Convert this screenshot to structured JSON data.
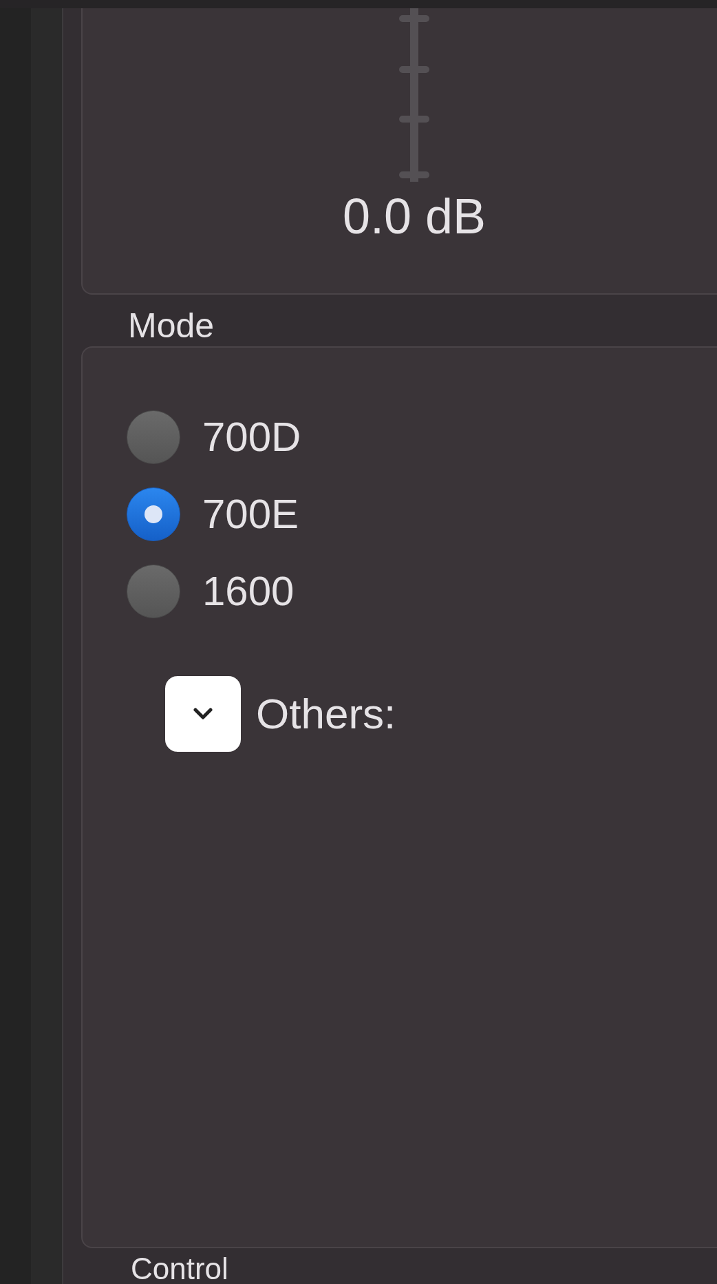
{
  "gain": {
    "reading": "0.0 dB"
  },
  "mode": {
    "label": "Mode",
    "options": [
      {
        "label": "700D",
        "selected": false
      },
      {
        "label": "700E",
        "selected": true
      },
      {
        "label": "1600",
        "selected": false
      }
    ],
    "others": {
      "label": "Others:",
      "expanded": false
    }
  },
  "next_section": {
    "label": "Control"
  }
}
